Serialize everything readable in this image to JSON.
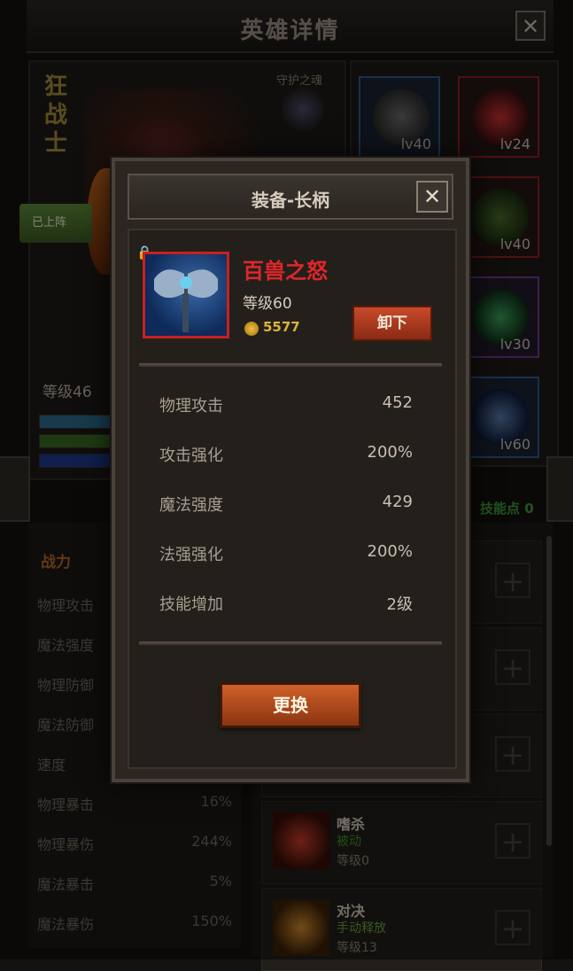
{
  "header": {
    "title": "英雄详情",
    "close_icon": "close-icon"
  },
  "hero": {
    "name": "狂战士",
    "guard_label": "守护之魂",
    "deployed_label": "已上阵",
    "level_label": "等级46"
  },
  "equipment_slots": [
    {
      "level": "lv40",
      "icon": "helmet-icon"
    },
    {
      "level": "lv24",
      "icon": "necklace-icon"
    },
    {
      "level": "lv40",
      "icon": "armor-icon"
    },
    {
      "level": "lv30",
      "icon": "ring-icon"
    },
    {
      "level": "lv60",
      "icon": "axe-icon"
    }
  ],
  "skill_points": "技能点 0",
  "stats": {
    "title": "战力",
    "rows": [
      {
        "label": "物理攻击",
        "value": ""
      },
      {
        "label": "魔法强度",
        "value": ""
      },
      {
        "label": "物理防御",
        "value": ""
      },
      {
        "label": "魔法防御",
        "value": ""
      },
      {
        "label": "速度",
        "value": ""
      },
      {
        "label": "物理暴击",
        "value": "16%"
      },
      {
        "label": "物理暴伤",
        "value": "244%"
      },
      {
        "label": "魔法暴击",
        "value": "5%"
      },
      {
        "label": "魔法暴伤",
        "value": "150%"
      }
    ]
  },
  "skills": [
    {
      "name": "嗜杀",
      "type": "被动",
      "level": "等级0"
    },
    {
      "name": "对决",
      "type": "手动释放",
      "level": "等级13"
    }
  ],
  "modal": {
    "title": "装备-长柄",
    "item_name": "百兽之怒",
    "item_level": "等级60",
    "price": "5577",
    "unequip_label": "卸下",
    "replace_label": "更换",
    "stats": [
      {
        "label": "物理攻击",
        "value": "452"
      },
      {
        "label": "攻击强化",
        "value": "200%"
      },
      {
        "label": "魔法强度",
        "value": "429"
      },
      {
        "label": "法强强化",
        "value": "200%"
      },
      {
        "label": "技能增加",
        "value": "2级"
      }
    ]
  },
  "colors": {
    "item_name": "#e0262a",
    "accent": "#c84a2a",
    "price": "#e0b23a"
  }
}
